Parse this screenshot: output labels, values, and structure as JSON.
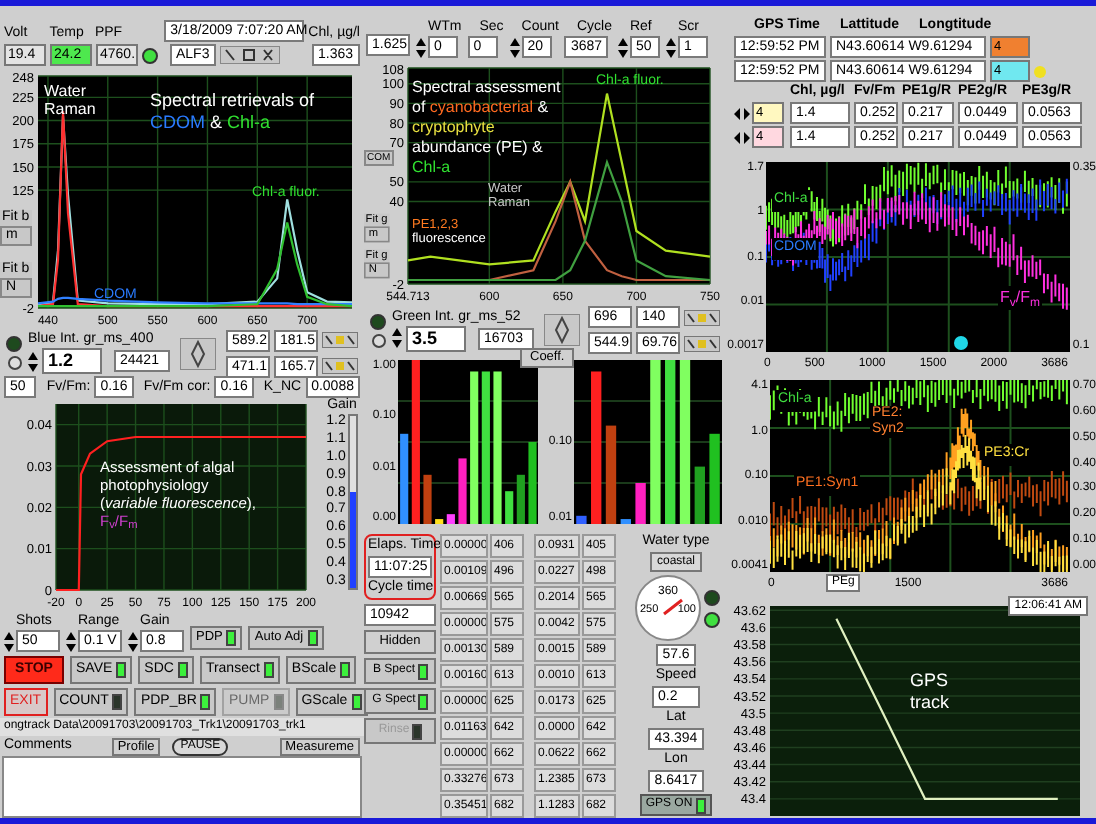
{
  "header": {
    "readouts": [
      {
        "label": "Volt",
        "value": "19.4",
        "highlight": false
      },
      {
        "label": "Temp",
        "value": "24.2",
        "highlight": true
      },
      {
        "label": "PPF",
        "value": "4760.",
        "highlight": false
      }
    ],
    "status_led_on": true,
    "datetime": "3/18/2009 7:07:20 AM",
    "mode": "ALF3",
    "chl_label": "Chl, µg/l",
    "chl_values": [
      "1.363",
      "1.625"
    ],
    "counters": [
      {
        "label": "WTm",
        "value": "0",
        "spinner": true
      },
      {
        "label": "Sec",
        "value": "0",
        "spinner": false
      },
      {
        "label": "Count",
        "value": "20",
        "spinner": true
      },
      {
        "label": "Cycle",
        "value": "3687",
        "spinner": false
      },
      {
        "label": "Ref",
        "value": "50",
        "spinner": true
      },
      {
        "label": "Scr",
        "value": "1",
        "spinner": true
      }
    ]
  },
  "spectrum_chart": {
    "fit_controls": [
      {
        "label": "Fit b",
        "value": "m"
      },
      {
        "label": "Fit b",
        "value": "N"
      }
    ],
    "captions": [
      {
        "lines": [
          [
            {
              "text": "Water",
              "color": "#ffffff"
            }
          ],
          [
            {
              "text": "Raman",
              "color": "#ffffff"
            }
          ]
        ]
      },
      {
        "lines": [
          [
            {
              "text": "Spectral retrievals of",
              "color": "#ffffff"
            }
          ],
          [
            {
              "text": "CDOM",
              "color": "#2a7bff"
            },
            {
              "text": " & ",
              "color": "#ffffff"
            },
            {
              "text": "Chl-a",
              "color": "#30e030"
            }
          ]
        ]
      },
      {
        "lines": [
          [
            {
              "text": "Chl-a fluor.",
              "color": "#30e030"
            }
          ]
        ]
      },
      {
        "lines": [
          [
            {
              "text": "CDOM",
              "color": "#2a7bff"
            }
          ]
        ]
      }
    ],
    "chart_data": {
      "type": "line",
      "grid": true,
      "xlim": [
        430,
        745
      ],
      "ylim": [
        -2,
        248
      ],
      "xticks": [
        440,
        500,
        550,
        600,
        650,
        700
      ],
      "yticks": [
        -2,
        125,
        150,
        175,
        200,
        225,
        248
      ],
      "x": [
        430,
        445,
        450,
        455,
        460,
        470,
        500,
        550,
        600,
        650,
        670,
        680,
        690,
        700,
        720,
        745
      ],
      "series": [
        {
          "color": "#a0e0e0",
          "values": [
            2,
            4,
            60,
            205,
            120,
            6,
            3,
            2,
            2,
            5,
            30,
            115,
            60,
            15,
            5,
            4
          ]
        },
        {
          "color": "#ff3030",
          "values": [
            0,
            2,
            50,
            210,
            100,
            2,
            0,
            0,
            0,
            0,
            0,
            0,
            0,
            0,
            0,
            0
          ]
        },
        {
          "color": "#3080ff",
          "values": [
            3,
            5,
            8,
            9,
            9,
            8,
            6,
            4,
            3,
            3,
            3,
            3,
            2,
            2,
            2,
            2
          ]
        },
        {
          "color": "#30c030",
          "values": [
            0,
            0,
            0,
            0,
            0,
            0,
            0,
            0,
            0,
            2,
            40,
            90,
            45,
            10,
            2,
            0
          ]
        }
      ]
    }
  },
  "blue_int": {
    "label": "Blue Int.",
    "sublabel": "gr_ms_400",
    "value": "1.2",
    "reading": "24421",
    "led_on": false,
    "pairs": [
      [
        "589.2",
        "181.5"
      ],
      [
        "471.1",
        "165.7"
      ]
    ]
  },
  "fv_row": {
    "points": "50",
    "readouts": [
      {
        "label": "Fv/Fm:",
        "value": "0.16"
      },
      {
        "label": "Fv/Fm cor:",
        "value": "0.16"
      },
      {
        "label": "K_NC",
        "value": "0.0088"
      }
    ]
  },
  "pe_chart": {
    "cdom_tab": "COM",
    "fit_controls": [
      {
        "label": "Fit g",
        "value": "m"
      },
      {
        "label": "Fit g",
        "value": "N"
      }
    ],
    "captions": [
      {
        "lines": [
          [
            {
              "text": "Spectral assessment",
              "color": "#ffffff"
            }
          ],
          [
            {
              "text": "of ",
              "color": "#ffffff"
            },
            {
              "text": "cyanobacterial",
              "color": "#ff6a20"
            },
            {
              "text": " &",
              "color": "#ffffff"
            }
          ],
          [
            {
              "text": "cryptophyte",
              "color": "#e8e040"
            }
          ],
          [
            {
              "text": "abundance (PE) &",
              "color": "#ffffff"
            }
          ],
          [
            {
              "text": "Chl-a",
              "color": "#30e030"
            }
          ]
        ]
      },
      {
        "lines": [
          [
            {
              "text": "Chl-a fluor.",
              "color": "#30e030"
            }
          ]
        ]
      },
      {
        "lines": [
          [
            {
              "text": "Water",
              "color": "#c8c8c8"
            }
          ],
          [
            {
              "text": "Raman",
              "color": "#c8c8c8"
            }
          ]
        ]
      },
      {
        "lines": [
          [
            {
              "text": "PE1,2,3",
              "color": "#ff7a20"
            }
          ],
          [
            {
              "text": "fluorescence",
              "color": "#ffffff"
            }
          ]
        ]
      }
    ],
    "chart_data": {
      "type": "line",
      "grid": true,
      "xlim": [
        544.713,
        750
      ],
      "ylim": [
        -2,
        108
      ],
      "xticks": [
        {
          "value": 544.713,
          "label": "544.713"
        },
        600,
        650,
        700,
        750
      ],
      "yticks": [
        -2,
        40,
        50,
        70,
        80,
        90,
        100,
        108
      ],
      "x": [
        544.713,
        560,
        600,
        630,
        645,
        655,
        665,
        680,
        690,
        700,
        720,
        750
      ],
      "series": [
        {
          "color": "#b0e020",
          "values": [
            10,
            12,
            8,
            10,
            35,
            50,
            30,
            95,
            60,
            25,
            15,
            12
          ]
        },
        {
          "color": "#c06040",
          "values": [
            0,
            0,
            0,
            5,
            30,
            50,
            20,
            5,
            2,
            0,
            0,
            0
          ]
        },
        {
          "color": "#40a040",
          "values": [
            0,
            0,
            0,
            0,
            0,
            5,
            20,
            60,
            40,
            10,
            2,
            0
          ]
        }
      ]
    }
  },
  "green_int": {
    "label": "Green Int.",
    "sublabel": "gr_ms_52",
    "value": "3.5",
    "reading": "16703",
    "led_on": false,
    "pairs": [
      [
        "696",
        "140"
      ],
      [
        "544.9",
        "69.76"
      ]
    ]
  },
  "coeff_button": "Coeff.",
  "bar_charts": [
    {
      "y_labels": [
        "1.00",
        "0.10",
        "0.01",
        "0.00"
      ]
    },
    {
      "y_labels": [
        "0.10",
        "0.01"
      ]
    }
  ],
  "fluorescence": {
    "captions": [
      {
        "lines": [
          [
            {
              "text": "Assessment of algal",
              "color": "#ffffff"
            }
          ],
          [
            {
              "text": "photophysiology",
              "color": "#ffffff"
            }
          ],
          [
            {
              "text": "(*variable fluorescence*),",
              "color": "#ffffff"
            }
          ],
          [
            {
              "text": "F$_{v}$/F$_{m}$",
              "color": "#d040d0"
            }
          ]
        ]
      }
    ],
    "chart_data": {
      "type": "line",
      "grid": true,
      "xlim": [
        -20,
        200
      ],
      "ylim": [
        0,
        0.045
      ],
      "xticks": [
        -20,
        0,
        25,
        50,
        75,
        100,
        125,
        150,
        175,
        200
      ],
      "yticks": [
        0,
        {
          "value": 0.01,
          "label": "0.01"
        },
        {
          "value": 0.02,
          "label": "0.02"
        },
        {
          "value": 0.03,
          "label": "0.03"
        },
        {
          "value": 0.04,
          "label": "0.04"
        }
      ],
      "x": [
        -20,
        0,
        2,
        10,
        25,
        50,
        100,
        200
      ],
      "series": [
        {
          "color": "#ff2020",
          "values": [
            0,
            0,
            0.028,
            0.033,
            0.036,
            0.037,
            0.037,
            0.037
          ]
        }
      ]
    },
    "gain_slider": {
      "label": "Gain",
      "ticks": [
        "1.2",
        "1.1",
        "1.0",
        "0.9",
        "0.8",
        "0.7",
        "0.6",
        "0.5",
        "0.4",
        "0.3"
      ],
      "level": 0.56
    }
  },
  "acquisition": {
    "controls": [
      {
        "label": "Shots",
        "value": "50"
      },
      {
        "label": "Range",
        "value": "0.1 V"
      },
      {
        "label": "Gain",
        "value": "0.8"
      }
    ],
    "toggles": [
      {
        "label": "PDP",
        "on": true
      },
      {
        "label": "Auto Adj",
        "on": true
      }
    ]
  },
  "buttons": [
    [
      {
        "label": "STOP",
        "kind": "stop",
        "disabled": false
      },
      {
        "label": "SAVE",
        "kind": "toggle",
        "led": true,
        "disabled": false
      },
      {
        "label": "SDC",
        "kind": "toggle",
        "led": true,
        "disabled": false
      },
      {
        "label": "Transect",
        "kind": "toggle",
        "led": true,
        "disabled": false
      },
      {
        "label": "BScale",
        "kind": "toggle",
        "led": true,
        "disabled": false
      }
    ],
    [
      {
        "label": "EXIT",
        "kind": "exit",
        "disabled": false
      },
      {
        "label": "COUNT",
        "kind": "toggle",
        "led": false,
        "disabled": false
      },
      {
        "label": "PDP_BR",
        "kind": "toggle",
        "led": true,
        "disabled": false
      },
      {
        "label": "PUMP",
        "kind": "toggle",
        "led": false,
        "disabled": true
      },
      {
        "label": "GScale",
        "kind": "toggle",
        "led": true,
        "disabled": false
      }
    ]
  ],
  "file_path": "ongtrack Data\\20091703\\20091703_Trk1\\20091703_trk1",
  "comments": {
    "label": "Comments",
    "profile_button": "Profile",
    "pause_button": "PAUSE",
    "measure_dropdown": "Measureme"
  },
  "timing": {
    "elapsed_label": "Elaps. Time",
    "elapsed": "11:07:25",
    "circled": true,
    "cycle_label": "Cycle time",
    "cycle": "10942",
    "hidden_button": "Hidden",
    "buttons": [
      {
        "label": "B Spect",
        "led": true,
        "disabled": false
      },
      {
        "label": "G Spect",
        "led": true,
        "disabled": false
      },
      {
        "label": "Rinse",
        "led": false,
        "disabled": true
      }
    ]
  },
  "table": {
    "rows": [
      [
        "0.00000",
        "406",
        "0.0931",
        "405"
      ],
      [
        "0.00109",
        "496",
        "0.0227",
        "498"
      ],
      [
        "0.00669",
        "565",
        "0.2014",
        "565"
      ],
      [
        "0.00000",
        "575",
        "0.0042",
        "575"
      ],
      [
        "0.00130",
        "589",
        "0.0015",
        "589"
      ],
      [
        "0.00160",
        "613",
        "0.0010",
        "613"
      ],
      [
        "0.00000",
        "625",
        "0.0173",
        "625"
      ],
      [
        "0.01163",
        "642",
        "0.0000",
        "642"
      ],
      [
        "0.00000",
        "662",
        "0.0622",
        "662"
      ],
      [
        "0.33276",
        "673",
        "1.2385",
        "673"
      ],
      [
        "0.35451",
        "682",
        "1.1283",
        "682"
      ]
    ]
  },
  "navigation": {
    "water_type_label": "Water type",
    "water_type": "coastal",
    "gauge": {
      "labels": [
        "360",
        "250",
        "100"
      ]
    },
    "leds": [
      false,
      true
    ],
    "heading": "57.6",
    "speed_label": "Speed",
    "speed": "0.2",
    "lat_label": "Lat",
    "lat": "43.394",
    "lon_label": "Lon",
    "lon": "8.6417",
    "gps_button": {
      "label": "GPS ON",
      "on": true
    }
  },
  "gps": {
    "headers": [
      "GPS Time",
      "Lattitude",
      "Longtitude"
    ],
    "rows": [
      {
        "time": "12:59:52 PM",
        "position": "N43.60614 W9.61294",
        "tag": "4",
        "color": "#f08030",
        "dot": false
      },
      {
        "time": "12:59:52 PM",
        "position": "N43.60614 W9.61294",
        "tag": "4",
        "color": "#70e8f0",
        "dot": true
      }
    ]
  },
  "ratios": {
    "headers": [
      "Chl, µg/l",
      "Fv/Fm",
      "PE1g/R",
      "PE2g/R",
      "PE3g/R"
    ],
    "rows": [
      {
        "tag": "4",
        "color": "#fff8c0",
        "values": [
          "1.4",
          "0.252",
          "0.217",
          "0.0449",
          "0.0563"
        ]
      },
      {
        "tag": "4",
        "color": "#ffd8e0",
        "values": [
          "1.4",
          "0.252",
          "0.217",
          "0.0449",
          "0.0563"
        ]
      }
    ]
  },
  "timeseries_charts": [
    {
      "captions": [
        {
          "lines": [
            [
              {
                "text": "Chl-a",
                "color": "#40e040"
              }
            ]
          ]
        },
        {
          "lines": [
            [
              {
                "text": "CDOM",
                "color": "#2a7bff"
              }
            ]
          ]
        },
        {
          "lines": [
            [
              {
                "text": "F$_{v}$/F$_{m}$",
                "color": "#ff30e0"
              }
            ]
          ]
        }
      ],
      "y_labels": [
        "1.7",
        "1",
        "0.1",
        "0.01",
        "0.0017"
      ],
      "y2_labels": [
        "0.35",
        "0.1"
      ],
      "x_labels": [
        "0",
        "500",
        "1000",
        "1500",
        "2000",
        "3686"
      ]
    },
    {
      "dropdown": "PEg",
      "captions": [
        {
          "lines": [
            [
              {
                "text": "Chl-a",
                "color": "#40e040"
              }
            ]
          ]
        },
        {
          "lines": [
            [
              {
                "text": "PE2:",
                "color": "#ff8030"
              }
            ],
            [
              {
                "text": "Syn2",
                "color": "#ff8030"
              }
            ]
          ]
        },
        {
          "lines": [
            [
              {
                "text": "PE1:Syn1",
                "color": "#ff7020"
              }
            ]
          ]
        },
        {
          "lines": [
            [
              {
                "text": "PE3:Cr",
                "color": "#ffe040"
              }
            ]
          ]
        }
      ],
      "y_labels": [
        "4.1",
        "1.0",
        "0.10",
        "0.010",
        "0.0041"
      ],
      "y2_labels": [
        "0.70",
        "0.60",
        "0.50",
        "0.40",
        "0.30",
        "0.20",
        "0.10",
        "0.00"
      ],
      "x_labels": [
        "0",
        "1500",
        "3686"
      ]
    }
  ],
  "gps_track": {
    "time": "12:06:41 AM",
    "captions": [
      {
        "lines": [
          [
            {
              "text": "GPS",
              "color": "#ffffff"
            }
          ],
          [
            {
              "text": "track",
              "color": "#ffffff"
            }
          ]
        ]
      }
    ],
    "chart_data": {
      "type": "line",
      "grid": true,
      "categories": [
        null,
        null,
        null,
        null,
        null,
        null,
        null
      ],
      "ylim": [
        43.38,
        43.625
      ],
      "yticks": [
        {
          "value": 43.62,
          "label": "43.62"
        },
        {
          "value": 43.6,
          "label": "43.6"
        },
        {
          "value": 43.58,
          "label": "43.58"
        },
        {
          "value": 43.56,
          "label": "43.56"
        },
        {
          "value": 43.54,
          "label": "43.54"
        },
        {
          "value": 43.52,
          "label": "43.52"
        },
        {
          "value": 43.5,
          "label": "43.5"
        },
        {
          "value": 43.48,
          "label": "43.48"
        },
        {
          "value": 43.46,
          "label": "43.46"
        },
        {
          "value": 43.44,
          "label": "43.44"
        },
        {
          "value": 43.42,
          "label": "43.42"
        },
        {
          "value": 43.4,
          "label": "43.4"
        }
      ],
      "series": [
        {
          "color": "#e0f0c0",
          "values": [
            null,
            43.61,
            43.505,
            43.4,
            43.4,
            43.4,
            43.4
          ]
        }
      ]
    }
  }
}
